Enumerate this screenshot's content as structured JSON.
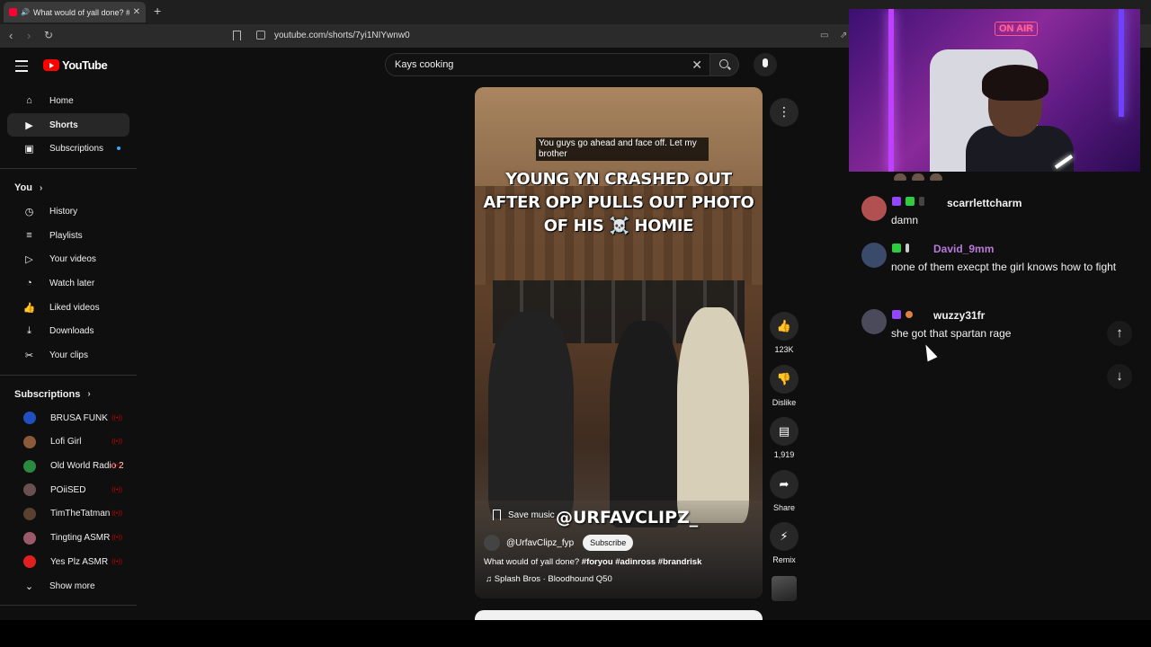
{
  "browser": {
    "tab_title": "What would of yall done? #fo",
    "url": "youtube.com/shorts/7yi1NIYwnw0"
  },
  "youtube": {
    "logo_text": "YouTube",
    "search": {
      "value": "Kays cooking",
      "placeholder": "Search"
    }
  },
  "sidebar": {
    "main": [
      {
        "label": "Home",
        "icon": "home-icon"
      },
      {
        "label": "Shorts",
        "icon": "shorts-icon",
        "active": true
      },
      {
        "label": "Subscriptions",
        "icon": "subscriptions-icon",
        "new_dot": true
      }
    ],
    "you_header": "You",
    "you_items": [
      {
        "label": "History",
        "icon": "history-icon"
      },
      {
        "label": "Playlists",
        "icon": "playlists-icon"
      },
      {
        "label": "Your videos",
        "icon": "your-videos-icon"
      },
      {
        "label": "Watch later",
        "icon": "clock-icon"
      },
      {
        "label": "Liked videos",
        "icon": "thumbs-up-icon"
      },
      {
        "label": "Downloads",
        "icon": "download-icon"
      },
      {
        "label": "Your clips",
        "icon": "scissors-icon"
      }
    ],
    "subs_header": "Subscriptions",
    "subscriptions": [
      {
        "label": "BRUSA FUNK",
        "color": "#2050c0"
      },
      {
        "label": "Lofi Girl",
        "color": "#8a5a3a"
      },
      {
        "label": "Old World Radio 2",
        "color": "#2a8a40"
      },
      {
        "label": "POiiSED",
        "color": "#6a5050"
      },
      {
        "label": "TimTheTatman",
        "color": "#5a4030"
      },
      {
        "label": "Tingting ASMR",
        "color": "#9a5a6a"
      },
      {
        "label": "Yes Plz ASMR",
        "color": "#e02020"
      }
    ],
    "show_more": "Show more"
  },
  "short": {
    "caption": "You guys go ahead and face off. Let my brother",
    "headline_lines": [
      "YOUNG YN CRASHED OUT",
      "AFTER OPP PULLS OUT PHOTO",
      "OF HIS ☠️ HOMIE"
    ],
    "watermark": "@URFAVCLIPZ_",
    "save_music": "Save music",
    "channel": "@UrfavClipz_fyp",
    "subscribe": "Subscribe",
    "description_plain": "What would of yall done? ",
    "description_tags": "#foryou #adinross #brandrisk",
    "music": "Splash Bros · Bloodhound Q50"
  },
  "actions": {
    "like_count": "123K",
    "dislike_label": "Dislike",
    "comments_count": "1,919",
    "share_label": "Share",
    "remix_label": "Remix"
  },
  "stream": {
    "on_air_sign": "ON AIR"
  },
  "chat": [
    {
      "user": "scarrlettcharm",
      "text": "damn",
      "user_color": "#f1f1f1",
      "avatar_color": "#b05050"
    },
    {
      "user": "David_9mm",
      "text": "none of them execpt the girl knows how to fight",
      "user_color": "#b87ad8",
      "avatar_color": "#3a4a6a"
    },
    {
      "user": "wuzzy31fr",
      "text": "she got that spartan rage",
      "user_color": "#f1f1f1",
      "avatar_color": "#4a4a5a"
    }
  ],
  "colors": {
    "youtube_red": "#ff0000",
    "page_bg": "#0f0f0f",
    "chip_bg": "#272727"
  }
}
